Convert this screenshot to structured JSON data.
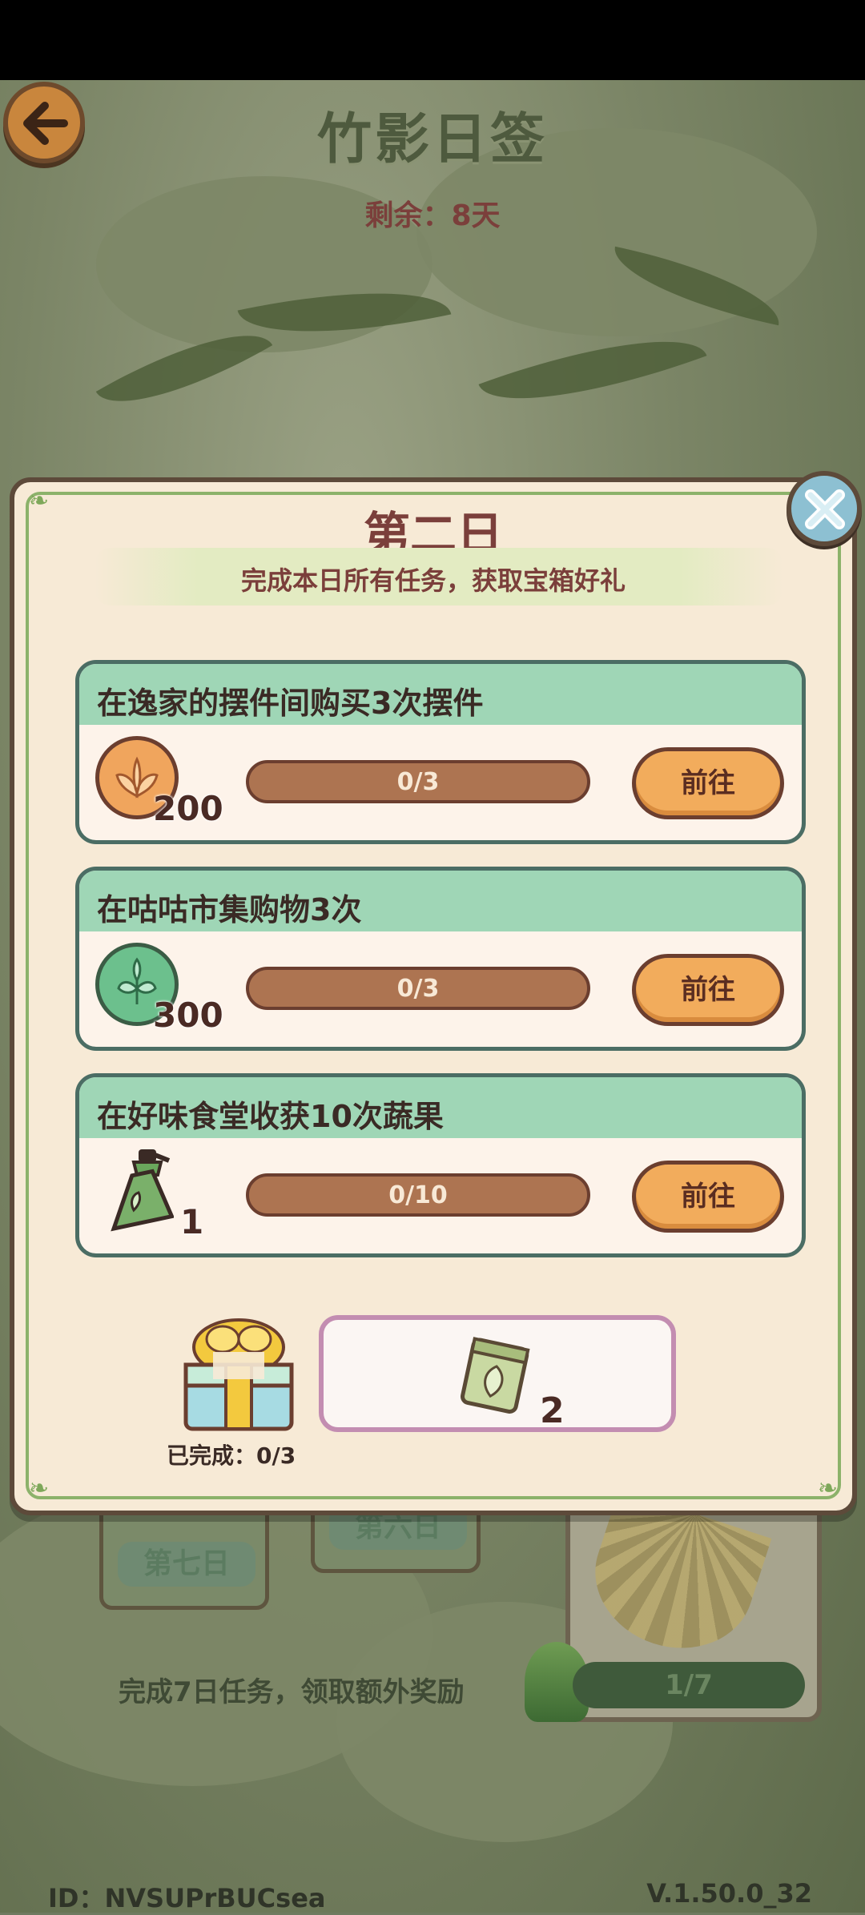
{
  "page": {
    "title": "竹影日签",
    "remaining": "剩余：8天",
    "day_seven": "第七日",
    "day_six": "第六日",
    "footer_hint": "完成7日任务，领取额外奖励",
    "bottom_progress": "1/7",
    "player_id": "ID：NVSUPrBUCsea",
    "version": "V.1.50.0_32"
  },
  "modal": {
    "title": "第二日",
    "subtitle": "完成本日所有任务，获取宝箱好礼",
    "tasks": [
      {
        "title": "在逸家的摆件间购买3次摆件",
        "reward_icon": "orange-leaf-coin-icon",
        "reward_qty": "200",
        "progress": "0/3",
        "progress_fraction": 0,
        "button": "前往"
      },
      {
        "title": "在咕咕市集购物3次",
        "reward_icon": "green-leaf-coin-icon",
        "reward_qty": "300",
        "progress": "0/3",
        "progress_fraction": 0,
        "button": "前往"
      },
      {
        "title": "在好味食堂收获10次蔬果",
        "reward_icon": "fertilizer-spray-icon",
        "reward_qty": "1",
        "progress": "0/10",
        "progress_fraction": 0,
        "button": "前往"
      }
    ],
    "completed": "已完成：0/3",
    "chest_reward_icon": "seed-packet-icon",
    "chest_reward_qty": "2"
  },
  "colors": {
    "title_brown": "#7b3f3b",
    "task_header": "#9fd6b6",
    "button_orange": "#f2ac5c",
    "progress_bar": "#ad7451"
  }
}
